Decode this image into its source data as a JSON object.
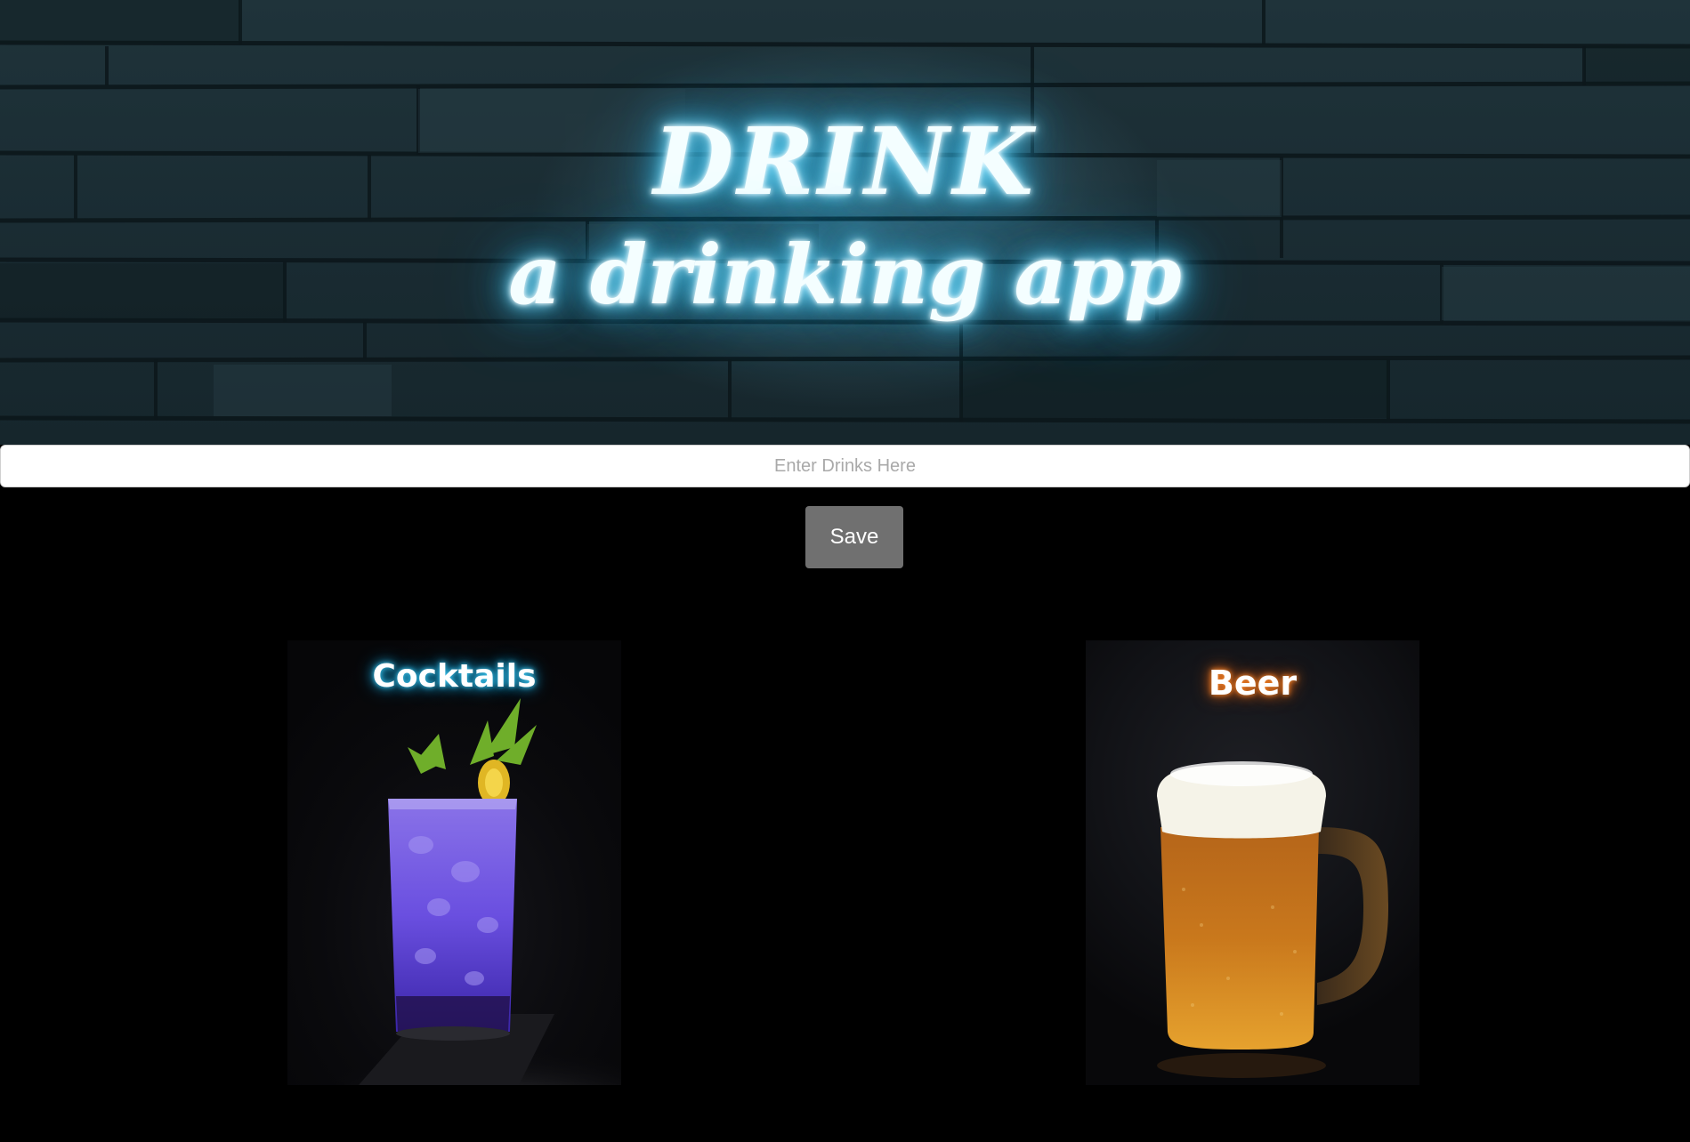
{
  "header": {
    "title": "DRINK",
    "subtitle": "a drinking app"
  },
  "search": {
    "placeholder": "Enter Drinks Here",
    "value": ""
  },
  "actions": {
    "save_label": "Save"
  },
  "categories": [
    {
      "label": "Cocktails",
      "glow_color": "#1aa7d8"
    },
    {
      "label": "Beer",
      "glow_color": "#d2621a"
    }
  ],
  "colors": {
    "page_background": "#000000",
    "neon_glow": "#4cc9f0",
    "save_button": "#707070",
    "input_background": "#ffffff"
  }
}
